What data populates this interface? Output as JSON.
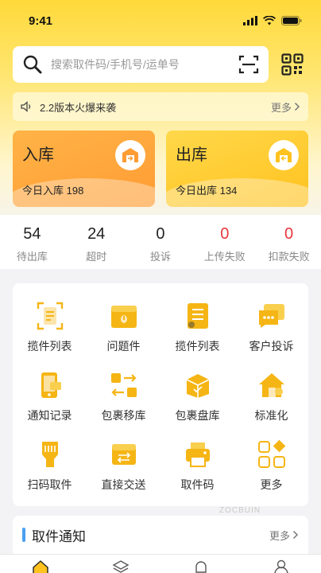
{
  "status_bar": {
    "time": "9:41"
  },
  "search": {
    "placeholder": "搜索取件码/手机号/运单号"
  },
  "notice": {
    "text": "2.2版本火爆来袭",
    "more": "更多"
  },
  "cards": {
    "inbound": {
      "title": "入库",
      "subtitle": "今日入库 198"
    },
    "outbound": {
      "title": "出库",
      "subtitle": "今日出库 134"
    }
  },
  "stats": [
    {
      "value": "54",
      "label": "待出库",
      "alert": false
    },
    {
      "value": "24",
      "label": "超时",
      "alert": false
    },
    {
      "value": "0",
      "label": "投诉",
      "alert": false
    },
    {
      "value": "0",
      "label": "上传失败",
      "alert": true
    },
    {
      "value": "0",
      "label": "扣款失败",
      "alert": true
    }
  ],
  "grid": [
    {
      "label": "揽件列表",
      "icon": "document-scan-icon"
    },
    {
      "label": "问题件",
      "icon": "warning-box-icon"
    },
    {
      "label": "揽件列表",
      "icon": "list-icon"
    },
    {
      "label": "客户投诉",
      "icon": "chat-icon"
    },
    {
      "label": "通知记录",
      "icon": "phone-message-icon"
    },
    {
      "label": "包裹移库",
      "icon": "transfer-icon"
    },
    {
      "label": "包裹盘库",
      "icon": "box-check-icon"
    },
    {
      "label": "标准化",
      "icon": "house-icon"
    },
    {
      "label": "扫码取件",
      "icon": "scanner-icon"
    },
    {
      "label": "直接交送",
      "icon": "box-exchange-icon"
    },
    {
      "label": "取件码",
      "icon": "printer-icon"
    },
    {
      "label": "更多",
      "icon": "more-grid-icon"
    }
  ],
  "watermark": "ZOCBUIN",
  "pickup": {
    "title": "取件通知",
    "more": "更多"
  },
  "colors": {
    "brand": "#ffc21f",
    "accent": "#ff9c33",
    "alert": "#e8363e",
    "icon": "#f5b514"
  }
}
